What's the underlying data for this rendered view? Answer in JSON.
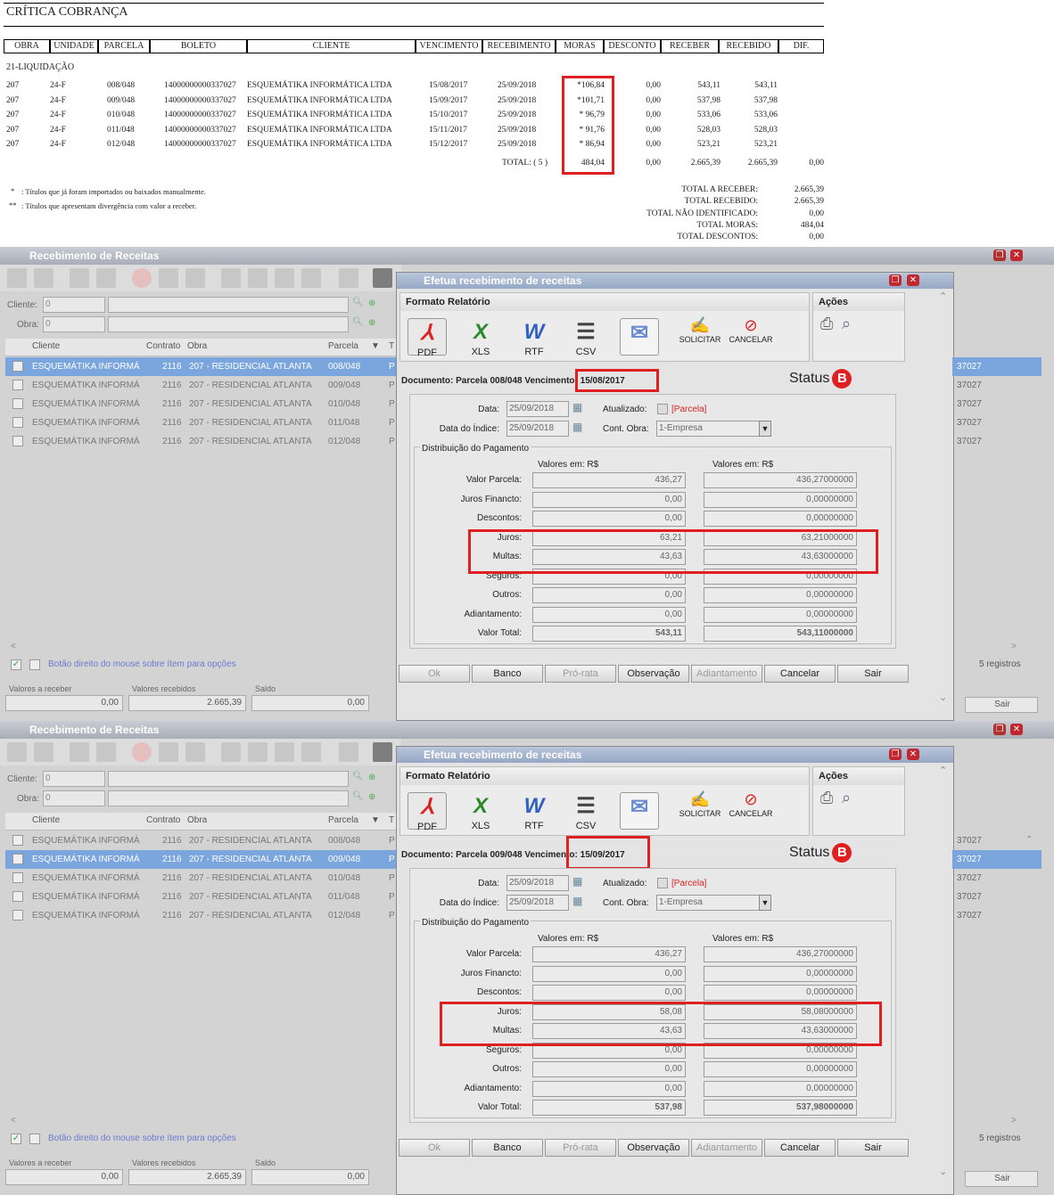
{
  "report": {
    "title": "CRÍTICA COBRANÇA",
    "columns": [
      "OBRA",
      "UNIDADE",
      "PARCELA",
      "BOLETO",
      "CLIENTE",
      "VENCIMENTO",
      "RECEBIMENTO",
      "MORAS",
      "DESCONTO",
      "RECEBER",
      "RECEBIDO",
      "DIF."
    ],
    "section": "21-LIQUIDAÇÃO",
    "rows": [
      {
        "obra": "207",
        "unidade": "24-F",
        "parcela": "008/048",
        "boleto": "14000000000337027",
        "cliente": "ESQUEMÁTIKA INFORMÁTICA LTDA",
        "vencimento": "15/08/2017",
        "recebimento": "25/09/2018",
        "moras": "*106,84",
        "desconto": "0,00",
        "receber": "543,11",
        "recebido": "543,11"
      },
      {
        "obra": "207",
        "unidade": "24-F",
        "parcela": "009/048",
        "boleto": "14000000000337027",
        "cliente": "ESQUEMÁTIKA INFORMÁTICA LTDA",
        "vencimento": "15/09/2017",
        "recebimento": "25/09/2018",
        "moras": "*101,71",
        "desconto": "0,00",
        "receber": "537,98",
        "recebido": "537,98"
      },
      {
        "obra": "207",
        "unidade": "24-F",
        "parcela": "010/048",
        "boleto": "14000000000337027",
        "cliente": "ESQUEMÁTIKA INFORMÁTICA LTDA",
        "vencimento": "15/10/2017",
        "recebimento": "25/09/2018",
        "moras": "* 96,79",
        "desconto": "0,00",
        "receber": "533,06",
        "recebido": "533,06"
      },
      {
        "obra": "207",
        "unidade": "24-F",
        "parcela": "011/048",
        "boleto": "14000000000337027",
        "cliente": "ESQUEMÁTIKA INFORMÁTICA LTDA",
        "vencimento": "15/11/2017",
        "recebimento": "25/09/2018",
        "moras": "* 91,76",
        "desconto": "0,00",
        "receber": "528,03",
        "recebido": "528,03"
      },
      {
        "obra": "207",
        "unidade": "24-F",
        "parcela": "012/048",
        "boleto": "14000000000337027",
        "cliente": "ESQUEMÁTIKA INFORMÁTICA LTDA",
        "vencimento": "15/12/2017",
        "recebimento": "25/09/2018",
        "moras": "* 86,94",
        "desconto": "0,00",
        "receber": "523,21",
        "recebido": "523,21"
      }
    ],
    "total_label": "TOTAL:  ( 5 )",
    "total_moras": "484,04",
    "total_desconto": "0,00",
    "total_receber": "2.665,39",
    "total_recebido": "2.665,39",
    "total_dif": "0,00",
    "note1_mark": "*",
    "note1": ": Títulos que já foram importados ou baixados manualmente.",
    "note2_mark": "**",
    "note2": ": Títulos que apresentam divergência com valor a receber.",
    "summary": [
      {
        "label": "TOTAL A RECEBER:",
        "value": "2.665,39"
      },
      {
        "label": "TOTAL RECEBIDO:",
        "value": "2.665,39"
      },
      {
        "label": "TOTAL NÃO IDENTIFICADO:",
        "value": "0,00"
      },
      {
        "label": "TOTAL MORAS:",
        "value": "484,04"
      },
      {
        "label": "TOTAL DESCONTOS:",
        "value": "0,00"
      }
    ]
  },
  "panels": [
    {
      "window_title": "Recebimento de Receitas",
      "cliente_label": "Cliente:",
      "cliente_value": "0",
      "obra_label": "Obra:",
      "obra_value": "0",
      "grid_headers": {
        "cliente": "Cliente",
        "contrato": "Contrato",
        "obra": "Obra",
        "parcela": "Parcela",
        "t": "T"
      },
      "grid_rows": [
        {
          "cliente": "ESQUEMÁTIKA INFORMÁ",
          "contrato": "2116",
          "obra": "207 - RESIDENCIAL ATLANTA",
          "parcela": "008/048",
          "t": "P",
          "right": "37027"
        },
        {
          "cliente": "ESQUEMÁTIKA INFORMÁ",
          "contrato": "2116",
          "obra": "207 - RESIDENCIAL ATLANTA",
          "parcela": "009/048",
          "t": "P",
          "right": "37027"
        },
        {
          "cliente": "ESQUEMÁTIKA INFORMÁ",
          "contrato": "2116",
          "obra": "207 - RESIDENCIAL ATLANTA",
          "parcela": "010/048",
          "t": "P",
          "right": "37027"
        },
        {
          "cliente": "ESQUEMÁTIKA INFORMÁ",
          "contrato": "2116",
          "obra": "207 - RESIDENCIAL ATLANTA",
          "parcela": "011/048",
          "t": "P",
          "right": "37027"
        },
        {
          "cliente": "ESQUEMÁTIKA INFORMÁ",
          "contrato": "2116",
          "obra": "207 - RESIDENCIAL ATLANTA",
          "parcela": "012/048",
          "t": "P",
          "right": "37027"
        }
      ],
      "selected_row": 0,
      "hint": "Botão direito do mouse sobre ítem para opções",
      "registros": "5 registros",
      "valores_receber_label": "Valores a receber",
      "valores_receber": "0,00",
      "valores_recebidos_label": "Valores recebidos",
      "valores_recebidos": "2.665,39",
      "saldo_label": "Saldo",
      "saldo": "0,00",
      "sair_label": "Sair",
      "dialog": {
        "title": "Efetua recebimento de receitas",
        "formato_title": "Formato Relatório",
        "acoes_title": "Ações",
        "formats": [
          "PDF",
          "XLS",
          "RTF",
          "CSV"
        ],
        "solicitar": "SOLICITAR",
        "cancelar_action": "CANCELAR",
        "documento_prefix": "Documento: Parcela 008/048 Vencimento:",
        "vencimento": "15/08/2017",
        "status_label": "Status",
        "status_badge": "B",
        "data_label": "Data:",
        "data_value": "25/09/2018",
        "data_indice_label": "Data do Índice:",
        "data_indice_value": "25/09/2018",
        "atualizado_label": "Atualizado:",
        "parcela_link": "[Parcela]",
        "cont_obra_label": "Cont. Obra:",
        "cont_obra_value": "1-Empresa",
        "distrib_title": "Distribuição do Pagamento",
        "valores_em": "Valores em: R$",
        "lines": [
          {
            "label": "Valor Parcela:",
            "v1": "436,27",
            "v2": "436,27000000"
          },
          {
            "label": "Juros Financto:",
            "v1": "0,00",
            "v2": "0,00000000"
          },
          {
            "label": "Descontos:",
            "v1": "0,00",
            "v2": "0,00000000"
          },
          {
            "label": "Juros:",
            "v1": "63,21",
            "v2": "63,21000000"
          },
          {
            "label": "Multas:",
            "v1": "43,63",
            "v2": "43,63000000"
          },
          {
            "label": "Seguros:",
            "v1": "0,00",
            "v2": "0,00000000"
          },
          {
            "label": "Outros:",
            "v1": "0,00",
            "v2": "0,00000000"
          },
          {
            "label": "Adiantamento:",
            "v1": "0,00",
            "v2": "0,00000000"
          },
          {
            "label": "Valor Total:",
            "v1": "543,11",
            "v2": "543,11000000"
          }
        ],
        "buttons": [
          "Ok",
          "Banco",
          "Pró-rata",
          "Observação",
          "Adiantamento",
          "Cancelar",
          "Sair"
        ]
      }
    },
    {
      "window_title": "Recebimento de Receitas",
      "cliente_label": "Cliente:",
      "cliente_value": "0",
      "obra_label": "Obra:",
      "obra_value": "0",
      "grid_headers": {
        "cliente": "Cliente",
        "contrato": "Contrato",
        "obra": "Obra",
        "parcela": "Parcela",
        "t": "T"
      },
      "grid_rows": [
        {
          "cliente": "ESQUEMÁTIKA INFORMÁ",
          "contrato": "2116",
          "obra": "207 - RESIDENCIAL ATLANTA",
          "parcela": "008/048",
          "t": "P",
          "right": "37027"
        },
        {
          "cliente": "ESQUEMÁTIKA INFORMÁ",
          "contrato": "2116",
          "obra": "207 - RESIDENCIAL ATLANTA",
          "parcela": "009/048",
          "t": "P",
          "right": "37027"
        },
        {
          "cliente": "ESQUEMÁTIKA INFORMÁ",
          "contrato": "2116",
          "obra": "207 - RESIDENCIAL ATLANTA",
          "parcela": "010/048",
          "t": "P",
          "right": "37027"
        },
        {
          "cliente": "ESQUEMÁTIKA INFORMÁ",
          "contrato": "2116",
          "obra": "207 - RESIDENCIAL ATLANTA",
          "parcela": "011/048",
          "t": "P",
          "right": "37027"
        },
        {
          "cliente": "ESQUEMÁTIKA INFORMÁ",
          "contrato": "2116",
          "obra": "207 - RESIDENCIAL ATLANTA",
          "parcela": "012/048",
          "t": "P",
          "right": "37027"
        }
      ],
      "selected_row": 1,
      "hint": "Botão direito do mouse sobre ítem para opções",
      "registros": "5 registros",
      "valores_receber_label": "Valores a receber",
      "valores_receber": "0,00",
      "valores_recebidos_label": "Valores recebidos",
      "valores_recebidos": "2.665,39",
      "saldo_label": "Saldo",
      "saldo": "0,00",
      "sair_label": "Sair",
      "dialog": {
        "title": "Efetua recebimento de receitas",
        "formato_title": "Formato Relatório",
        "acoes_title": "Ações",
        "formats": [
          "PDF",
          "XLS",
          "RTF",
          "CSV"
        ],
        "solicitar": "SOLICITAR",
        "cancelar_action": "CANCELAR",
        "documento_prefix": "Documento: Parcela 009/048 Vencimento:",
        "vencimento": "15/09/2017",
        "status_label": "Status",
        "status_badge": "B",
        "data_label": "Data:",
        "data_value": "25/09/2018",
        "data_indice_label": "Data do Índice:",
        "data_indice_value": "25/09/2018",
        "atualizado_label": "Atualizado:",
        "parcela_link": "[Parcela]",
        "cont_obra_label": "Cont. Obra:",
        "cont_obra_value": "1-Empresa",
        "distrib_title": "Distribuição do Pagamento",
        "valores_em": "Valores em: R$",
        "lines": [
          {
            "label": "Valor Parcela:",
            "v1": "436,27",
            "v2": "436,27000000"
          },
          {
            "label": "Juros Financto:",
            "v1": "0,00",
            "v2": "0,00000000"
          },
          {
            "label": "Descontos:",
            "v1": "0,00",
            "v2": "0,00000000"
          },
          {
            "label": "Juros:",
            "v1": "58,08",
            "v2": "58,08000000"
          },
          {
            "label": "Multas:",
            "v1": "43,63",
            "v2": "43,63000000"
          },
          {
            "label": "Seguros:",
            "v1": "0,00",
            "v2": "0,00000000"
          },
          {
            "label": "Outros:",
            "v1": "0,00",
            "v2": "0,00000000"
          },
          {
            "label": "Adiantamento:",
            "v1": "0,00",
            "v2": "0,00000000"
          },
          {
            "label": "Valor Total:",
            "v1": "537,98",
            "v2": "537,98000000"
          }
        ],
        "buttons": [
          "Ok",
          "Banco",
          "Pró-rata",
          "Observação",
          "Adiantamento",
          "Cancelar",
          "Sair"
        ]
      }
    }
  ],
  "colors": {
    "highlight": "#e02020",
    "selection": "#7aa6dd",
    "titlebar": "#a8adb8"
  }
}
